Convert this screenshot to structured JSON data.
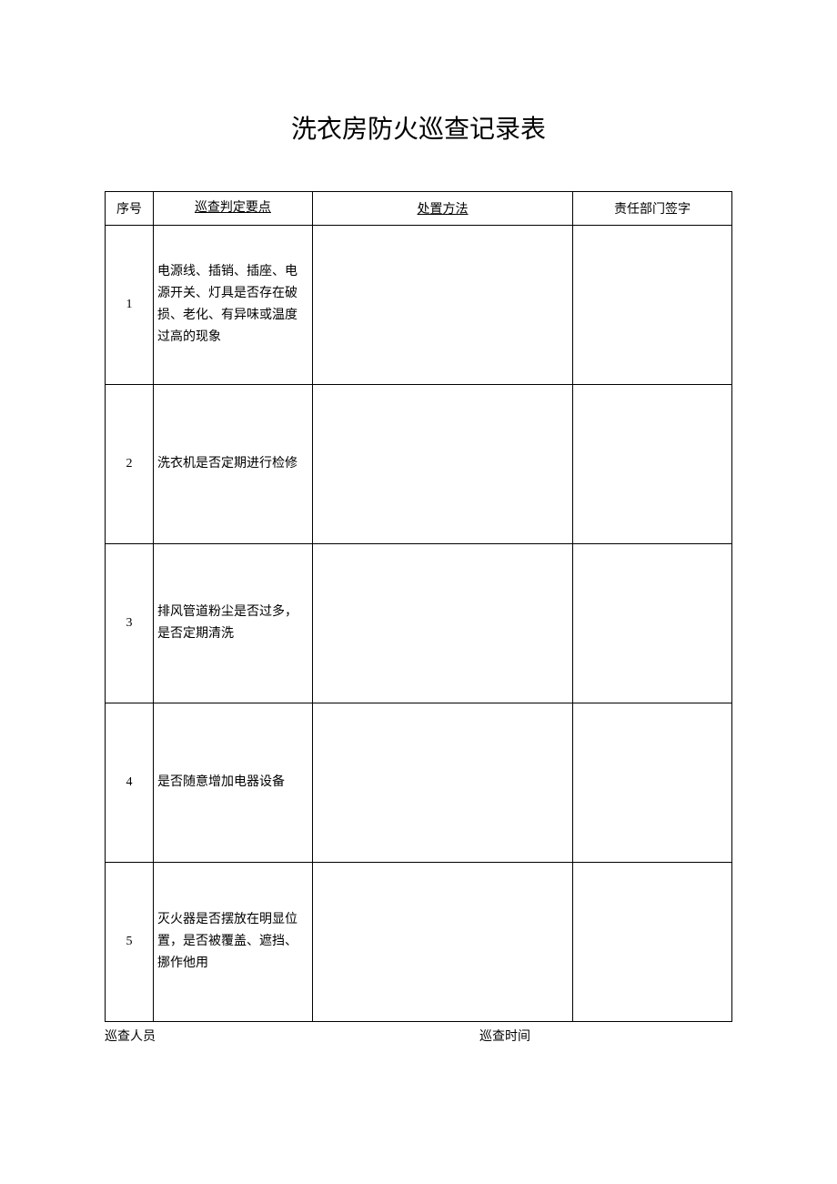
{
  "title": "洗衣房防火巡查记录表",
  "headers": {
    "index": "序号",
    "point": "巡查判定要点",
    "method": "处置方法",
    "sign": "责任部门签字"
  },
  "rows": [
    {
      "index": "1",
      "point": "电源线、插销、插座、电源开关、灯具是否存在破损、老化、有异味或温度过高的现象",
      "method": "",
      "sign": ""
    },
    {
      "index": "2",
      "point": "洗衣机是否定期进行检修",
      "method": "",
      "sign": ""
    },
    {
      "index": "3",
      "point": "排风管道粉尘是否过多，是否定期清洗",
      "method": "",
      "sign": ""
    },
    {
      "index": "4",
      "point": "是否随意增加电器设备",
      "method": "",
      "sign": ""
    },
    {
      "index": "5",
      "point": "灭火器是否摆放在明显位置，是否被覆盖、遮挡、挪作他用",
      "method": "",
      "sign": ""
    }
  ],
  "footer": {
    "inspector": "巡查人员",
    "time": "巡查时间"
  }
}
